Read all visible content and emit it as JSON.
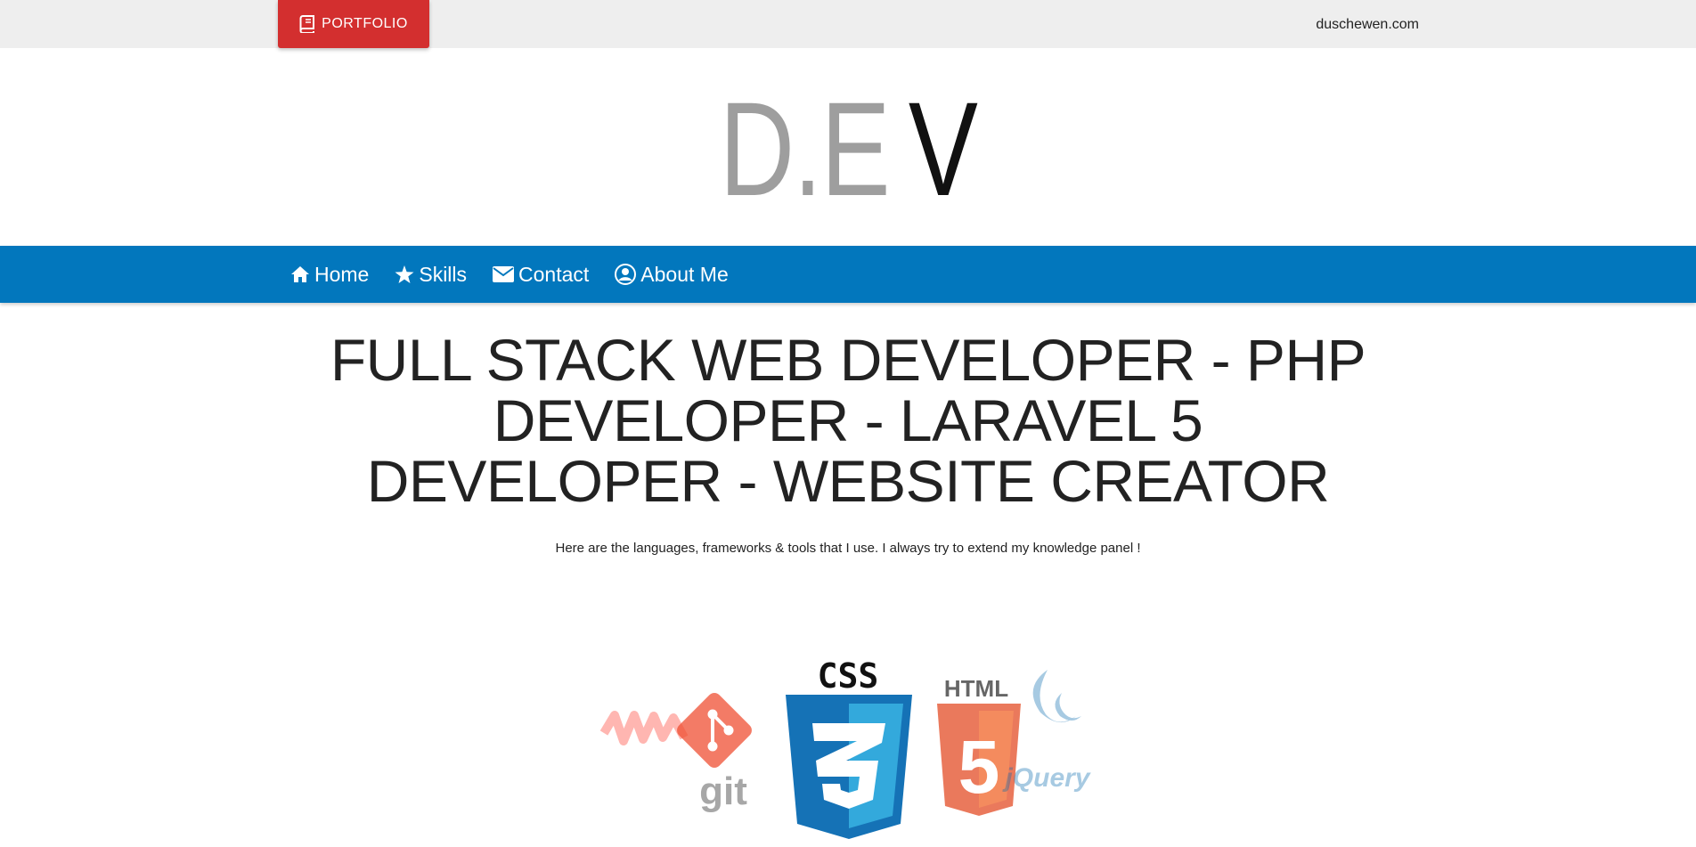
{
  "topbar": {
    "portfolio_label": "PORTFOLIO",
    "site_link": "duschewen.com"
  },
  "logo": {
    "part1": "D.E",
    "part2": "V"
  },
  "nav": {
    "items": [
      {
        "label": "Home",
        "icon": "home-icon"
      },
      {
        "label": "Skills",
        "icon": "star-icon"
      },
      {
        "label": "Contact",
        "icon": "envelope-icon"
      },
      {
        "label": "About Me",
        "icon": "user-circle-icon"
      }
    ]
  },
  "main": {
    "headline": "FULL STACK WEB DEVELOPER - PHP DEVELOPER - LARAVEL 5 DEVELOPER - WEBSITE CREATOR",
    "subtitle": "Here are the languages, frameworks & tools that I use. I always try to extend my knowledge panel !"
  },
  "tech_logos": {
    "git": "git",
    "css_label": "CSS",
    "css_number": "3",
    "html_label": "HTML",
    "html_number": "5",
    "jquery": "jQuery"
  },
  "colors": {
    "topbar": "#eeeeee",
    "portfolio_button": "#d32f2f",
    "nav": "#0277bd",
    "logo_grey": "#9e9e9e",
    "css_blue": "#1572b6",
    "html_orange": "#e44d26",
    "git_orange": "#f05033"
  }
}
